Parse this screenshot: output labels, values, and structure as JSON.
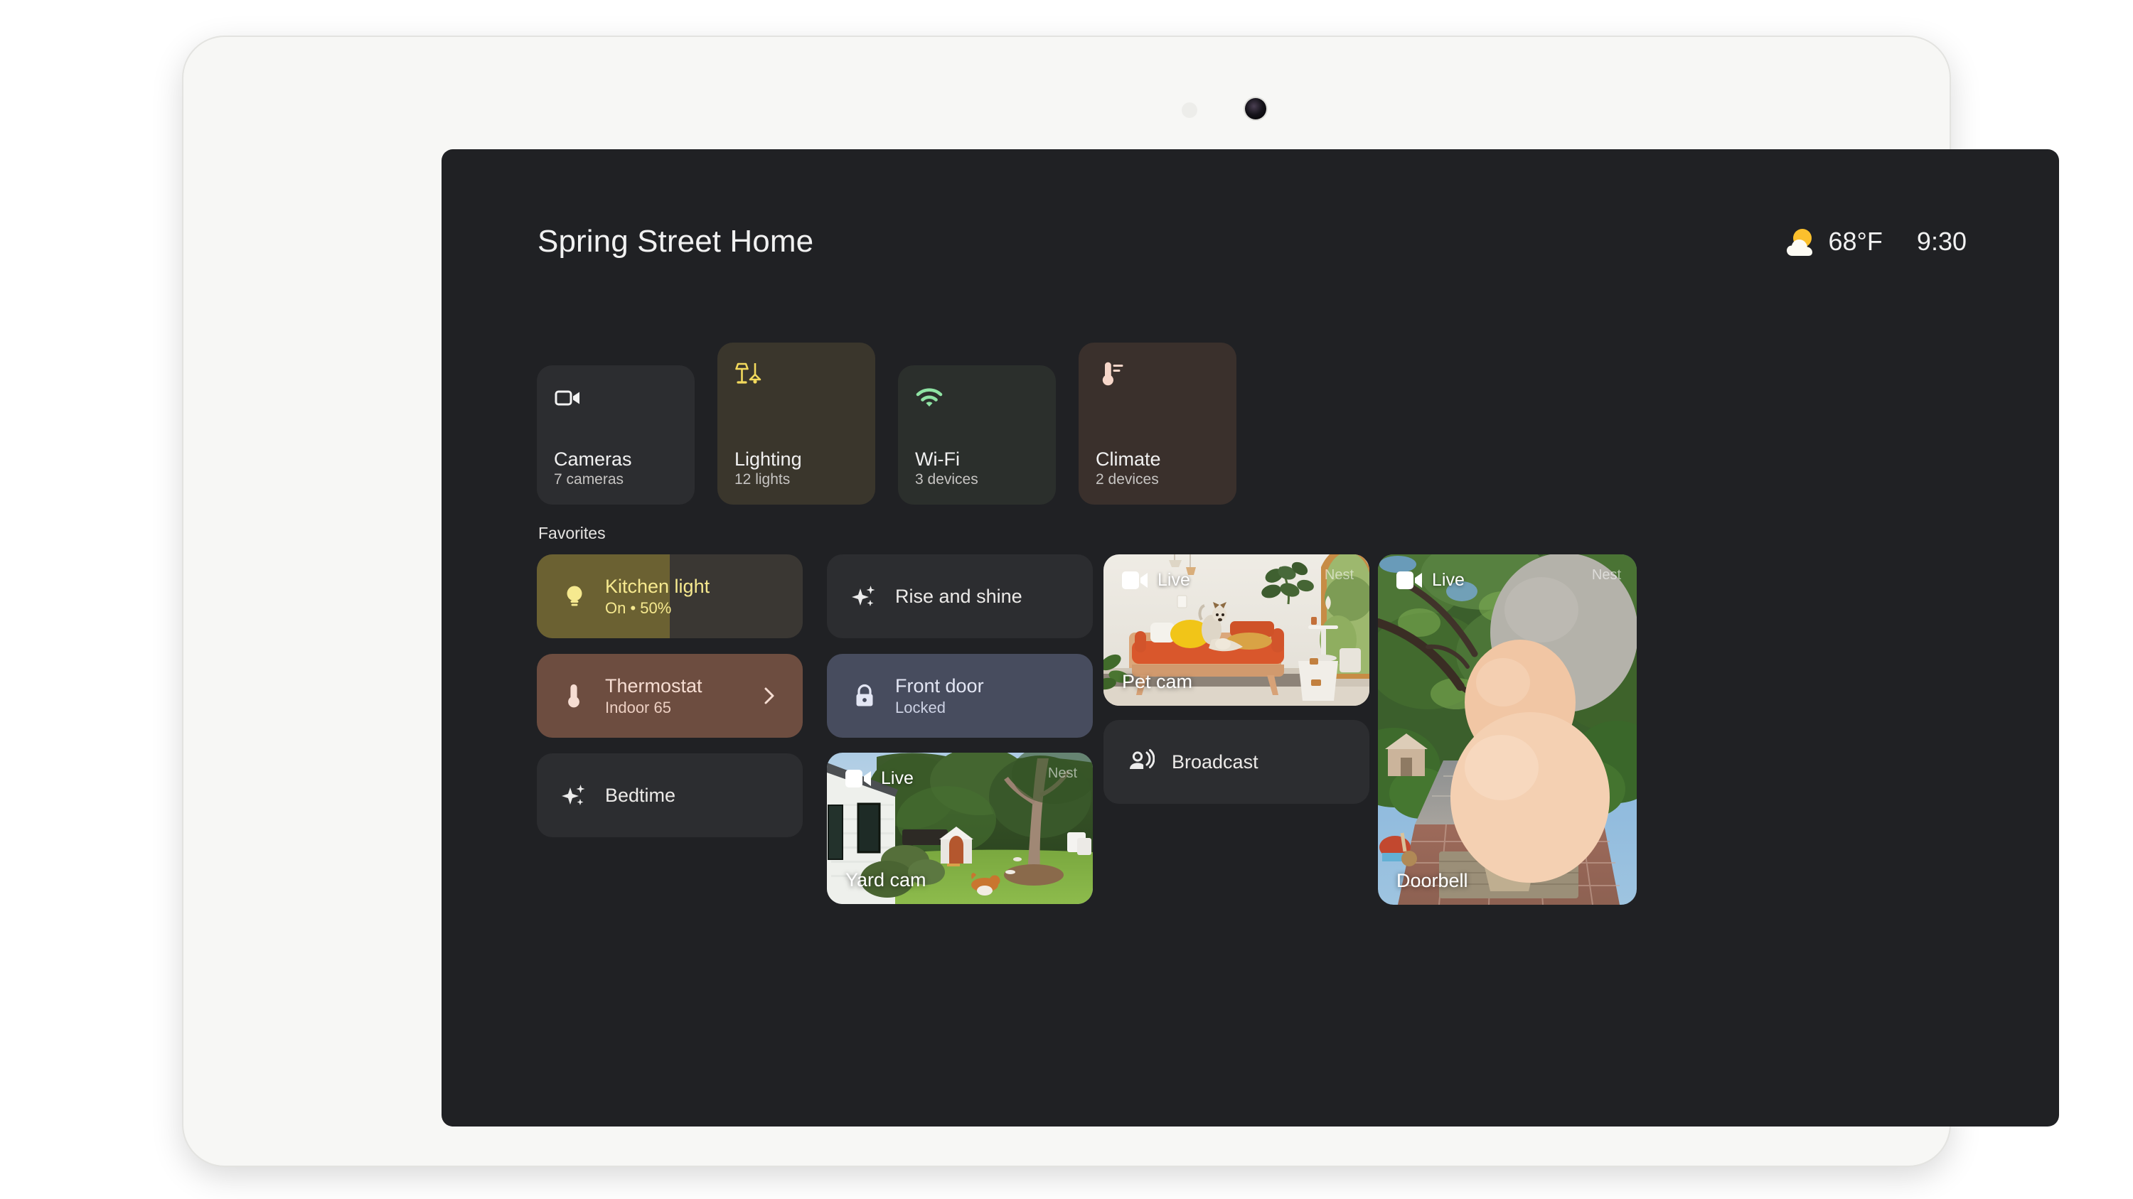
{
  "device": {
    "bezel_camera_icon": "front-camera-lens",
    "bezel_sensor_icon": "ambient-light-sensor"
  },
  "header": {
    "home_title": "Spring Street Home",
    "weather": {
      "icon": "partly-cloudy-day-icon",
      "temperature": "68°F"
    },
    "clock": "9:30"
  },
  "quick_tiles": [
    {
      "id": "cameras",
      "icon": "video-camera-icon",
      "label": "Cameras",
      "sub": "7 cameras",
      "bg": "#2c2d30",
      "icon_color": "#f3f3f3",
      "height": "short"
    },
    {
      "id": "lighting",
      "icon": "lamps-icon",
      "label": "Lighting",
      "sub": "12 lights",
      "bg": "#3a362c",
      "icon_color": "#f2d95c",
      "height": "tall"
    },
    {
      "id": "wifi",
      "icon": "wifi-icon",
      "label": "Wi-Fi",
      "sub": "3 devices",
      "bg": "#2b2f2c",
      "icon_color": "#8fe3a4",
      "height": "short"
    },
    {
      "id": "climate",
      "icon": "thermometer-icon",
      "label": "Climate",
      "sub": "2 devices",
      "bg": "#3a302c",
      "icon_color": "#f6d6c9",
      "height": "tall"
    }
  ],
  "favorites": {
    "section_label": "Favorites",
    "cards": [
      {
        "id": "kitchen-light",
        "type": "device",
        "icon": "lightbulb-icon",
        "title": "Kitchen light",
        "sub": "On • 50%",
        "brightness_percent": 50,
        "fill_color": "#6b6132",
        "track_color": "#3a3733",
        "text_color": "#f6e98f"
      },
      {
        "id": "thermostat",
        "type": "device",
        "icon": "thermometer-icon",
        "title": "Thermostat",
        "sub": "Indoor 65",
        "chevron": "chevron-right-icon",
        "bg_color": "#6d4d40"
      },
      {
        "id": "bedtime",
        "type": "automation",
        "icon": "sparkles-icon",
        "title": "Bedtime",
        "sub": "",
        "bg_color": "#2c2d30"
      },
      {
        "id": "rise-and-shine",
        "type": "automation",
        "icon": "sparkles-icon",
        "title": "Rise and shine",
        "sub": "",
        "bg_color": "#2c2d30"
      },
      {
        "id": "front-door",
        "type": "lock",
        "icon": "lock-closed-icon",
        "title": "Front door",
        "sub": "Locked",
        "bg_color": "#474c5e"
      },
      {
        "id": "broadcast",
        "type": "action",
        "icon": "broadcast-icon",
        "title": "Broadcast",
        "sub": "",
        "bg_color": "#2c2d30"
      }
    ],
    "cameras": [
      {
        "id": "pet-cam",
        "name": "Pet cam",
        "live_badge": "Live",
        "live_icon": "video-camera-icon",
        "watermark": "Nest",
        "scene": "indoor living room, dog on orange daybed sofa with yellow pillow, houseplants, white wall, arched door to garden"
      },
      {
        "id": "yard-cam",
        "name": "Yard cam",
        "live_badge": "Live",
        "live_icon": "video-camera-icon",
        "watermark": "Nest",
        "scene": "backyard with white house siding, windows, green hedge, white dog house, tree, corgi on lawn"
      },
      {
        "id": "doorbell",
        "name": "Doorbell",
        "live_badge": "Live",
        "live_icon": "video-camera-icon",
        "watermark": "Nest",
        "scene": "front walkway, oak tree and garden, large balloons in foreground, brick path, doormat with gift basket"
      }
    ]
  }
}
